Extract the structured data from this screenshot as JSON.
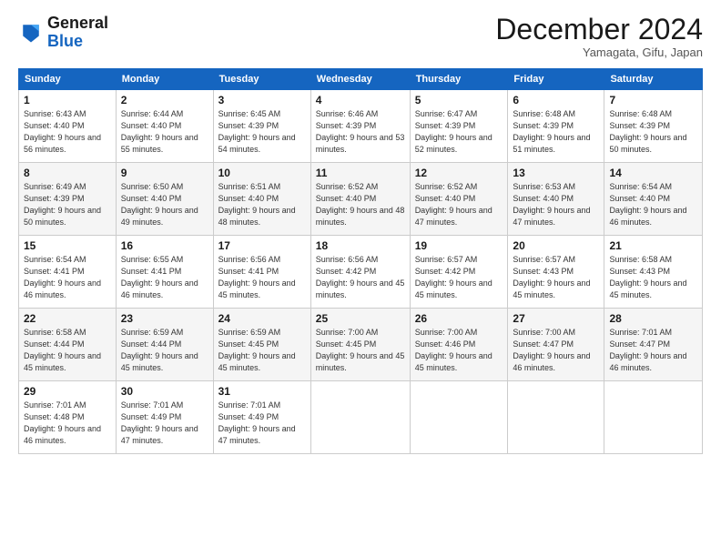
{
  "header": {
    "logo_line1": "General",
    "logo_line2": "Blue",
    "month_title": "December 2024",
    "subtitle": "Yamagata, Gifu, Japan"
  },
  "weekdays": [
    "Sunday",
    "Monday",
    "Tuesday",
    "Wednesday",
    "Thursday",
    "Friday",
    "Saturday"
  ],
  "weeks": [
    [
      {
        "day": "1",
        "sunrise": "Sunrise: 6:43 AM",
        "sunset": "Sunset: 4:40 PM",
        "daylight": "Daylight: 9 hours and 56 minutes."
      },
      {
        "day": "2",
        "sunrise": "Sunrise: 6:44 AM",
        "sunset": "Sunset: 4:40 PM",
        "daylight": "Daylight: 9 hours and 55 minutes."
      },
      {
        "day": "3",
        "sunrise": "Sunrise: 6:45 AM",
        "sunset": "Sunset: 4:39 PM",
        "daylight": "Daylight: 9 hours and 54 minutes."
      },
      {
        "day": "4",
        "sunrise": "Sunrise: 6:46 AM",
        "sunset": "Sunset: 4:39 PM",
        "daylight": "Daylight: 9 hours and 53 minutes."
      },
      {
        "day": "5",
        "sunrise": "Sunrise: 6:47 AM",
        "sunset": "Sunset: 4:39 PM",
        "daylight": "Daylight: 9 hours and 52 minutes."
      },
      {
        "day": "6",
        "sunrise": "Sunrise: 6:48 AM",
        "sunset": "Sunset: 4:39 PM",
        "daylight": "Daylight: 9 hours and 51 minutes."
      },
      {
        "day": "7",
        "sunrise": "Sunrise: 6:48 AM",
        "sunset": "Sunset: 4:39 PM",
        "daylight": "Daylight: 9 hours and 50 minutes."
      }
    ],
    [
      {
        "day": "8",
        "sunrise": "Sunrise: 6:49 AM",
        "sunset": "Sunset: 4:39 PM",
        "daylight": "Daylight: 9 hours and 50 minutes."
      },
      {
        "day": "9",
        "sunrise": "Sunrise: 6:50 AM",
        "sunset": "Sunset: 4:40 PM",
        "daylight": "Daylight: 9 hours and 49 minutes."
      },
      {
        "day": "10",
        "sunrise": "Sunrise: 6:51 AM",
        "sunset": "Sunset: 4:40 PM",
        "daylight": "Daylight: 9 hours and 48 minutes."
      },
      {
        "day": "11",
        "sunrise": "Sunrise: 6:52 AM",
        "sunset": "Sunset: 4:40 PM",
        "daylight": "Daylight: 9 hours and 48 minutes."
      },
      {
        "day": "12",
        "sunrise": "Sunrise: 6:52 AM",
        "sunset": "Sunset: 4:40 PM",
        "daylight": "Daylight: 9 hours and 47 minutes."
      },
      {
        "day": "13",
        "sunrise": "Sunrise: 6:53 AM",
        "sunset": "Sunset: 4:40 PM",
        "daylight": "Daylight: 9 hours and 47 minutes."
      },
      {
        "day": "14",
        "sunrise": "Sunrise: 6:54 AM",
        "sunset": "Sunset: 4:40 PM",
        "daylight": "Daylight: 9 hours and 46 minutes."
      }
    ],
    [
      {
        "day": "15",
        "sunrise": "Sunrise: 6:54 AM",
        "sunset": "Sunset: 4:41 PM",
        "daylight": "Daylight: 9 hours and 46 minutes."
      },
      {
        "day": "16",
        "sunrise": "Sunrise: 6:55 AM",
        "sunset": "Sunset: 4:41 PM",
        "daylight": "Daylight: 9 hours and 46 minutes."
      },
      {
        "day": "17",
        "sunrise": "Sunrise: 6:56 AM",
        "sunset": "Sunset: 4:41 PM",
        "daylight": "Daylight: 9 hours and 45 minutes."
      },
      {
        "day": "18",
        "sunrise": "Sunrise: 6:56 AM",
        "sunset": "Sunset: 4:42 PM",
        "daylight": "Daylight: 9 hours and 45 minutes."
      },
      {
        "day": "19",
        "sunrise": "Sunrise: 6:57 AM",
        "sunset": "Sunset: 4:42 PM",
        "daylight": "Daylight: 9 hours and 45 minutes."
      },
      {
        "day": "20",
        "sunrise": "Sunrise: 6:57 AM",
        "sunset": "Sunset: 4:43 PM",
        "daylight": "Daylight: 9 hours and 45 minutes."
      },
      {
        "day": "21",
        "sunrise": "Sunrise: 6:58 AM",
        "sunset": "Sunset: 4:43 PM",
        "daylight": "Daylight: 9 hours and 45 minutes."
      }
    ],
    [
      {
        "day": "22",
        "sunrise": "Sunrise: 6:58 AM",
        "sunset": "Sunset: 4:44 PM",
        "daylight": "Daylight: 9 hours and 45 minutes."
      },
      {
        "day": "23",
        "sunrise": "Sunrise: 6:59 AM",
        "sunset": "Sunset: 4:44 PM",
        "daylight": "Daylight: 9 hours and 45 minutes."
      },
      {
        "day": "24",
        "sunrise": "Sunrise: 6:59 AM",
        "sunset": "Sunset: 4:45 PM",
        "daylight": "Daylight: 9 hours and 45 minutes."
      },
      {
        "day": "25",
        "sunrise": "Sunrise: 7:00 AM",
        "sunset": "Sunset: 4:45 PM",
        "daylight": "Daylight: 9 hours and 45 minutes."
      },
      {
        "day": "26",
        "sunrise": "Sunrise: 7:00 AM",
        "sunset": "Sunset: 4:46 PM",
        "daylight": "Daylight: 9 hours and 45 minutes."
      },
      {
        "day": "27",
        "sunrise": "Sunrise: 7:00 AM",
        "sunset": "Sunset: 4:47 PM",
        "daylight": "Daylight: 9 hours and 46 minutes."
      },
      {
        "day": "28",
        "sunrise": "Sunrise: 7:01 AM",
        "sunset": "Sunset: 4:47 PM",
        "daylight": "Daylight: 9 hours and 46 minutes."
      }
    ],
    [
      {
        "day": "29",
        "sunrise": "Sunrise: 7:01 AM",
        "sunset": "Sunset: 4:48 PM",
        "daylight": "Daylight: 9 hours and 46 minutes."
      },
      {
        "day": "30",
        "sunrise": "Sunrise: 7:01 AM",
        "sunset": "Sunset: 4:49 PM",
        "daylight": "Daylight: 9 hours and 47 minutes."
      },
      {
        "day": "31",
        "sunrise": "Sunrise: 7:01 AM",
        "sunset": "Sunset: 4:49 PM",
        "daylight": "Daylight: 9 hours and 47 minutes."
      },
      null,
      null,
      null,
      null
    ]
  ]
}
